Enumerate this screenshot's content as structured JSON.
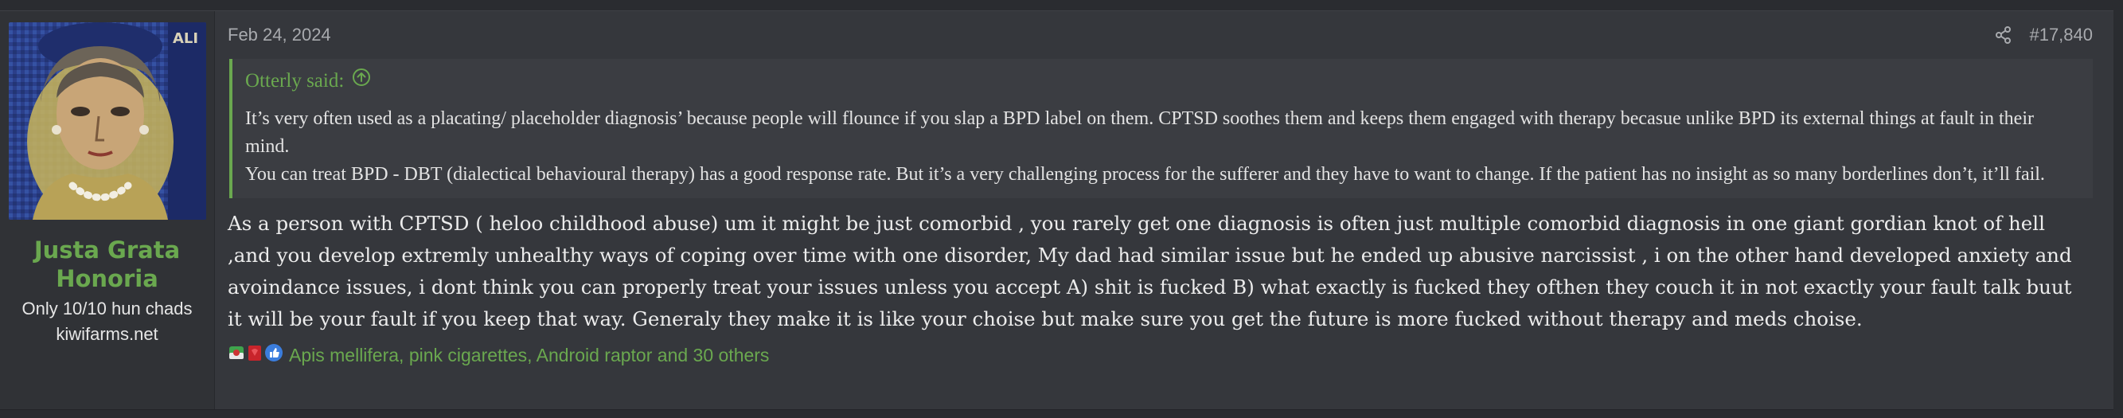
{
  "user": {
    "name": "Justa Grata Honoria",
    "title": "Only 10/10 hun chads",
    "site": "kiwifarms.net",
    "avatar_icon": "mosaic-portrait-avatar",
    "name_color": "#6aa84f"
  },
  "post": {
    "date": "Feb 24, 2024",
    "number": "#17,840",
    "share_icon": "share-icon"
  },
  "quote": {
    "author": "Otterly said:",
    "arrow_icon": "arrow-up-circle-icon",
    "lines": [
      "It’s very often used as a placating/ placeholder diagnosis’ because people will flounce if you slap a BPD label on them. CPTSD soothes them and keeps them engaged with therapy becasue unlike BPD its external things at fault in their mind.",
      "You can treat BPD - DBT (dialectical behavioural therapy) has a good response rate. But it’s a very challenging process for the sufferer and they have to want to change. If the patient has no insight as so many borderlines don’t, it’ll fail."
    ]
  },
  "content": "As a person with CPTSD ( heloo childhood abuse) um it might be just comorbid , you rarely get one diagnosis is often just multiple comorbid diagnosis in one giant gordian knot of hell ,and you develop extremly unhealthy ways of coping over time with one disorder, My dad had similar issue but he ended up abusive narcissist , i on the other hand developed anxiety and avoindance issues, i dont think you can properly treat your issues unless you accept A) shit is fucked B) what exactly is fucked they ofthen they couch it in not exactly your fault talk buut it will be your fault if you keep that way. Generaly they make it is like your choise but make sure you get the future is more fucked without therapy and meds choise.",
  "reactions": {
    "icons": [
      "winner-reaction-icon",
      "heart-reaction-icon",
      "like-reaction-icon"
    ],
    "text": "Apis mellifera, pink cigarettes, Android raptor and 30 others",
    "color": "#6aa84f"
  }
}
